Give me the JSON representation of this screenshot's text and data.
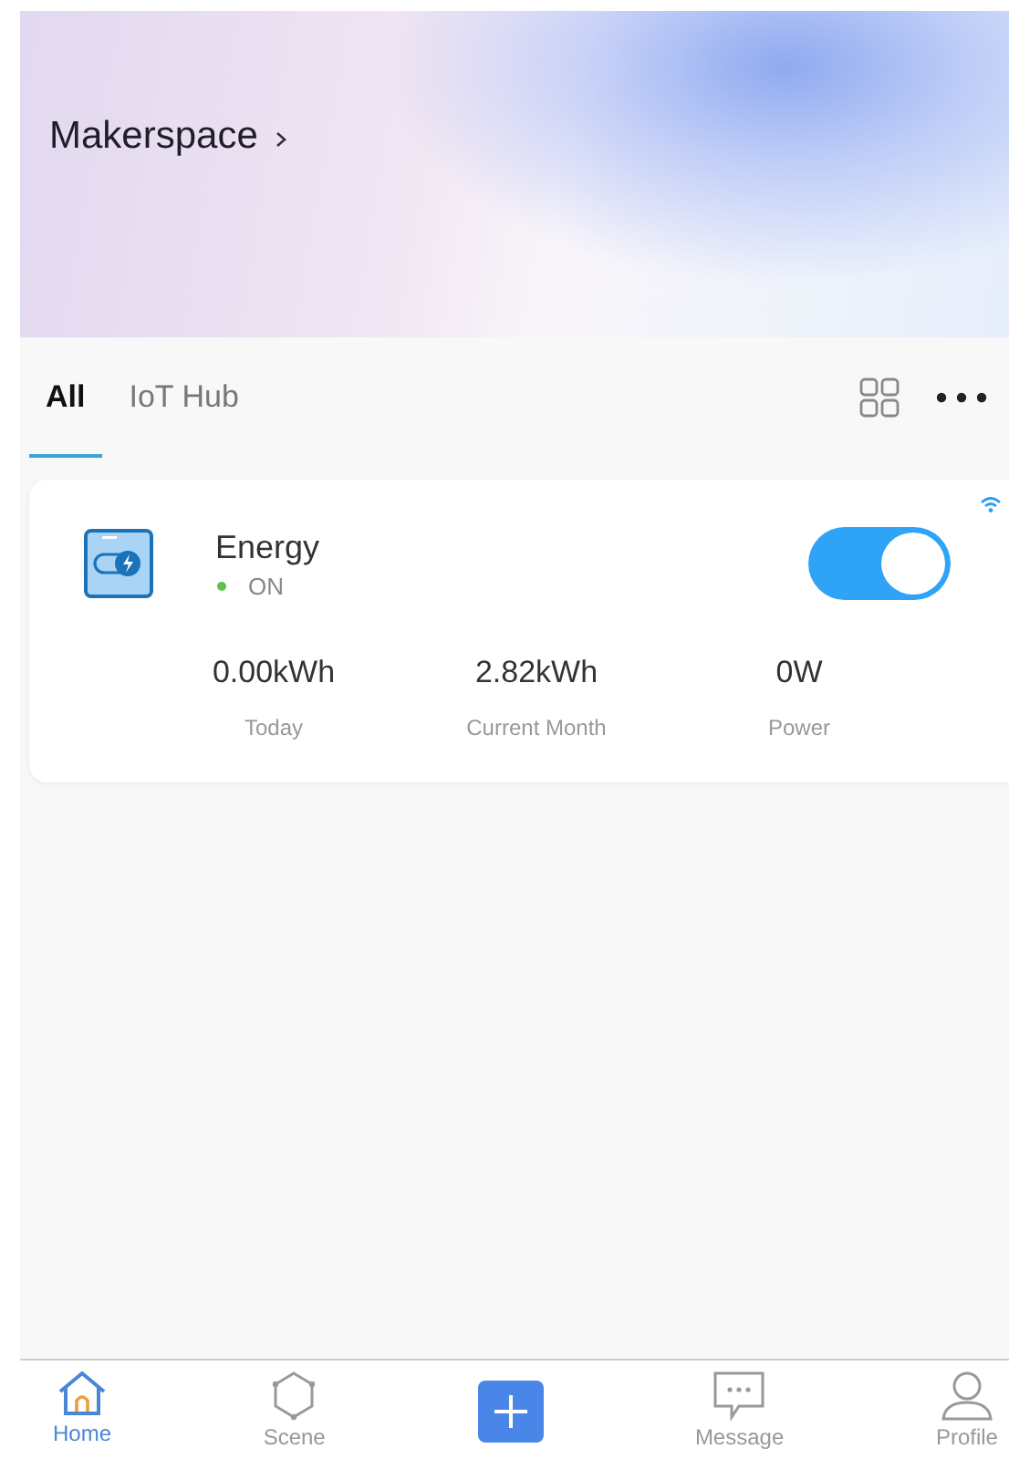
{
  "header": {
    "title": "Makerspace"
  },
  "tabs": [
    {
      "label": "All",
      "selected": true
    },
    {
      "label": "IoT Hub",
      "selected": false
    }
  ],
  "devices": [
    {
      "name": "Energy",
      "status": "ON",
      "online": true,
      "on": true,
      "stats": [
        {
          "value": "0.00kWh",
          "label": "Today"
        },
        {
          "value": "2.82kWh",
          "label": "Current Month"
        },
        {
          "value": "0W",
          "label": "Power"
        }
      ]
    }
  ],
  "nav": [
    {
      "kind": "home",
      "label": "Home",
      "selected": true
    },
    {
      "kind": "scene",
      "label": "Scene",
      "selected": false
    },
    {
      "kind": "add"
    },
    {
      "kind": "message",
      "label": "Message",
      "selected": false
    },
    {
      "kind": "profile",
      "label": "Profile",
      "selected": false
    }
  ]
}
